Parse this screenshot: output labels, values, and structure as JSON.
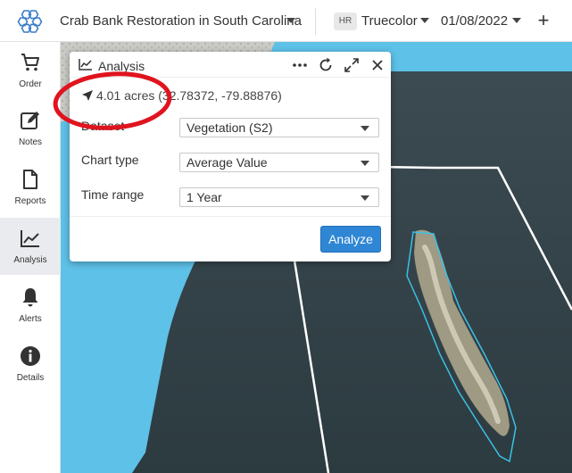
{
  "header": {
    "project_title": "Crab Bank Restoration in South Carolina",
    "layer_badge": "HR",
    "layer_name": "Truecolor",
    "date": "01/08/2022",
    "add_label": "+"
  },
  "sidebar": {
    "items": [
      {
        "label": "Order",
        "icon": "cart-icon",
        "active": false
      },
      {
        "label": "Notes",
        "icon": "edit-icon",
        "active": false
      },
      {
        "label": "Reports",
        "icon": "document-icon",
        "active": false
      },
      {
        "label": "Analysis",
        "icon": "line-chart-icon",
        "active": true
      },
      {
        "label": "Alerts",
        "icon": "bell-icon",
        "active": false
      },
      {
        "label": "Details",
        "icon": "info-icon",
        "active": false
      }
    ]
  },
  "panel": {
    "title": "Analysis",
    "area_text": "4.01 acres (32.78372, -79.88876)",
    "fields": [
      {
        "label": "Dataset",
        "value": "Vegetation (S2)"
      },
      {
        "label": "Chart type",
        "value": "Average Value"
      },
      {
        "label": "Time range",
        "value": "1 Year"
      }
    ],
    "analyze_label": "Analyze"
  },
  "colors": {
    "accent": "#2f86d4",
    "annotation": "#e0141e",
    "water": "#5ec1e8",
    "aoi_outline": "#3cc0e6"
  }
}
